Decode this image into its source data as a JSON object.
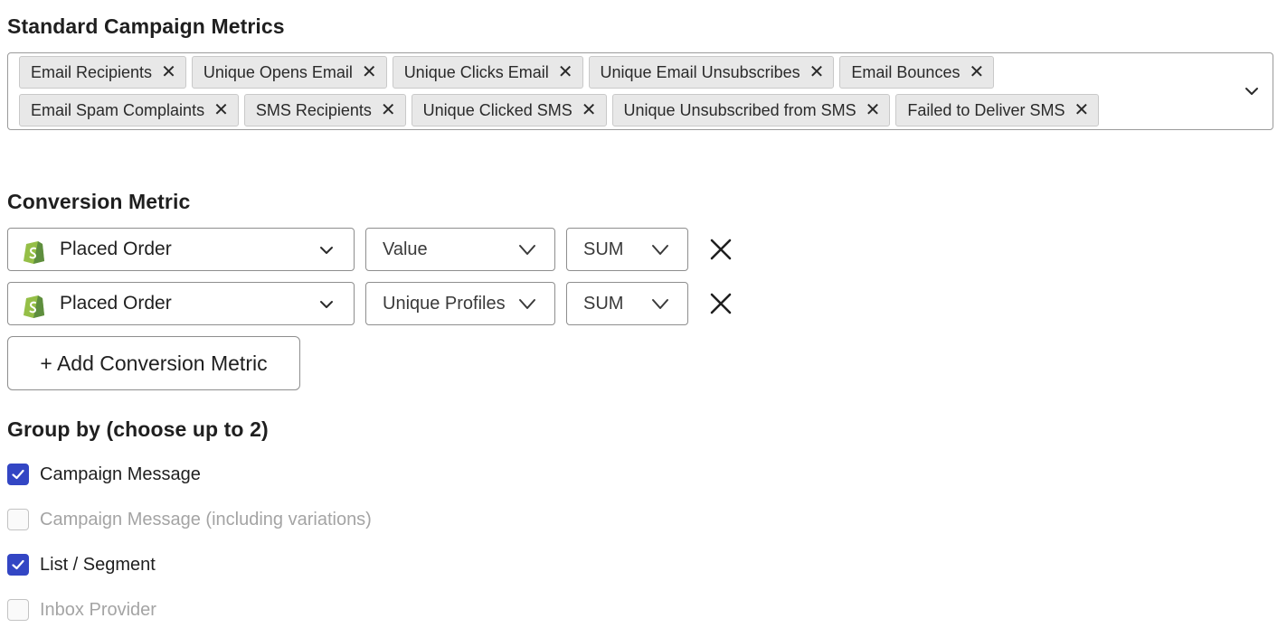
{
  "standard_metrics": {
    "title": "Standard Campaign Metrics",
    "row1": [
      "Email Recipients",
      "Unique Opens Email",
      "Unique Clicks Email",
      "Unique Email Unsubscribes",
      "Email Bounces"
    ],
    "row2": [
      "Email Spam Complaints",
      "SMS Recipients",
      "Unique Clicked SMS",
      "Unique Unsubscribed from SMS",
      "Failed to Deliver SMS"
    ],
    "remove_glyph": "✕"
  },
  "conversion": {
    "title": "Conversion Metric",
    "rows": [
      {
        "metric": "Placed Order",
        "property": "Value",
        "aggregate": "SUM"
      },
      {
        "metric": "Placed Order",
        "property": "Unique Profiles",
        "aggregate": "SUM"
      }
    ],
    "add_label": "+ Add Conversion Metric",
    "metric_icon": "shopify-icon"
  },
  "group_by": {
    "title": "Group by (choose up to 2)",
    "options": [
      {
        "label": "Campaign Message",
        "checked": true,
        "enabled": true
      },
      {
        "label": "Campaign Message (including variations)",
        "checked": false,
        "enabled": false
      },
      {
        "label": "List / Segment",
        "checked": true,
        "enabled": true
      },
      {
        "label": "Inbox Provider",
        "checked": false,
        "enabled": false
      }
    ]
  },
  "colors": {
    "checkbox_accent": "#3346c4",
    "shopify_green": "#95bf47"
  }
}
